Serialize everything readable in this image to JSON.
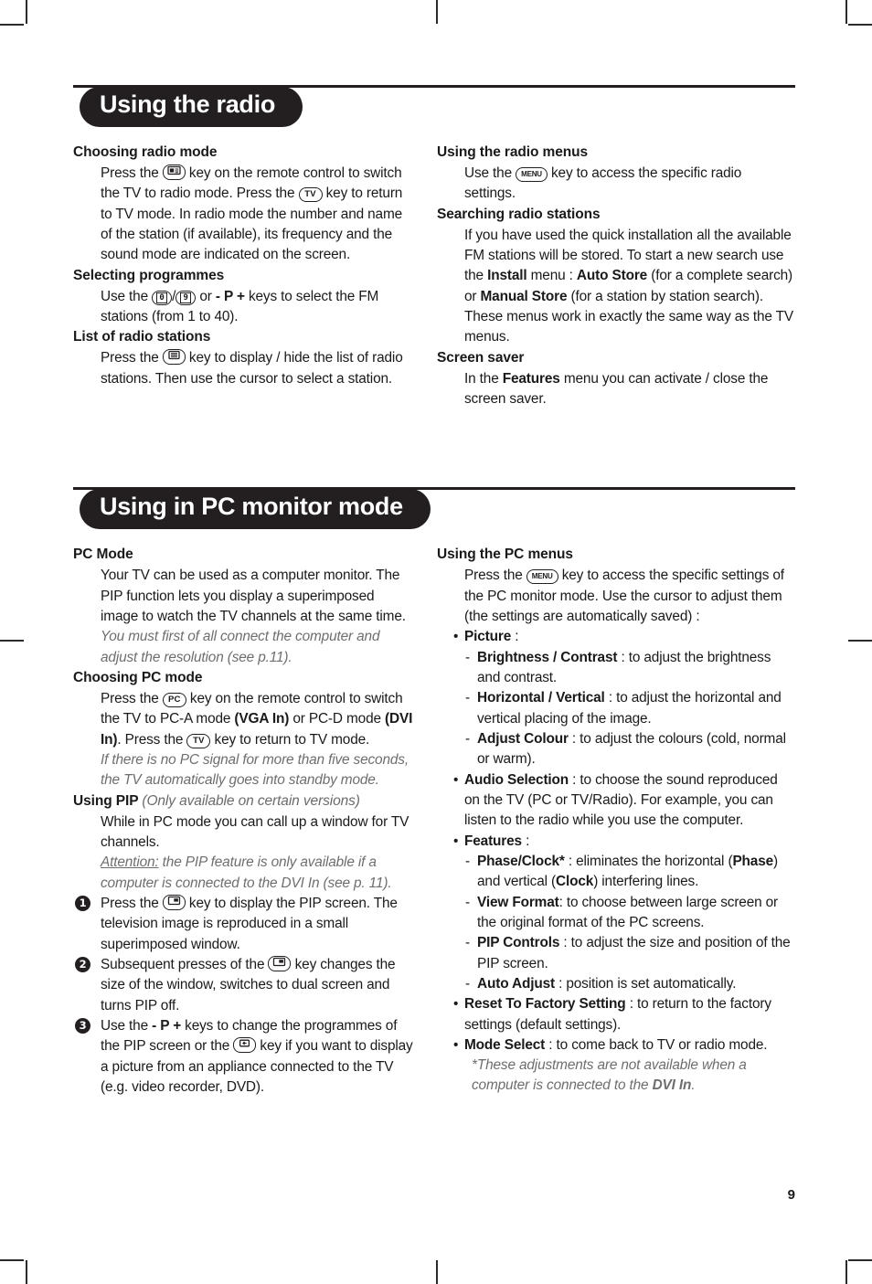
{
  "page": {
    "number": "9"
  },
  "sections": [
    {
      "banner": "Using the radio",
      "left": {
        "choosing_radio_mode": {
          "heading": "Choosing radio mode",
          "text_1": "Press the ",
          "icon_1": "radio-key-icon",
          "text_2": " key on the remote control to switch the TV to radio mode.  Press the ",
          "icon_2": "tv-key-icon",
          "text_3": " key to return to TV mode.  In radio mode the number and name of the station (if available), its frequency and the sound mode are indicated on the screen."
        },
        "selecting_programmes": {
          "heading": "Selecting programmes",
          "text_1": "Use the ",
          "icon_1": "digit-zero-key-icon",
          "separator": "/",
          "icon_2": "digit-nine-key-icon",
          "text_2": " or ",
          "bold_1": "- P +",
          "text_3": " keys to select the FM stations (from 1 to 40)."
        },
        "list_of_radio_stations": {
          "heading": "List of radio stations",
          "text_1": "Press the ",
          "icon_1": "list-key-icon",
          "text_2": " key to display / hide the list of radio stations. Then use the cursor to select a station."
        }
      },
      "right": {
        "using_the_radio_menus": {
          "heading": "Using the radio menus",
          "text_1": "Use the ",
          "icon_1": "menu-key-icon",
          "text_2": " key to access the specific radio settings."
        },
        "searching_radio_stations": {
          "heading": "Searching radio stations",
          "text_1": "If you have used the quick installation all the available FM stations will be stored. To start a new search use the ",
          "bold_1": "Install",
          "text_2": " menu : ",
          "bold_2": "Auto Store",
          "text_3": " (for a complete search) or ",
          "bold_3": "Manual Store",
          "text_4": " (for a station by station search). These menus work in exactly the same way as the TV menus."
        },
        "screen_saver": {
          "heading": "Screen saver",
          "text_1": "In the ",
          "bold_1": "Features",
          "text_2": " menu you can activate / close the screen saver."
        }
      }
    },
    {
      "banner": "Using in PC monitor mode",
      "left": {
        "pc_mode": {
          "heading": "PC Mode",
          "text_1": "Your TV can be used as a computer monitor. The PIP function lets you display a superimposed image to watch the TV channels at the same time.",
          "note_1": "You must first of all connect the computer and adjust the resolution (see p.11)."
        },
        "choosing_pc_mode": {
          "heading": "Choosing PC mode",
          "text_1": "Press the ",
          "icon_1": "pc-key-icon",
          "text_2": " key on the remote control to switch the TV to PC-A mode ",
          "bold_1": "(VGA In)",
          "text_3": " or PC-D mode ",
          "bold_2": "(DVI In)",
          "text_4": ". Press the ",
          "icon_2": "tv-key-icon",
          "text_5": " key to return to TV mode.",
          "note_1": "If there is no PC signal for more than five seconds, the TV automatically goes into standby mode."
        },
        "using_pip": {
          "heading": "Using PIP",
          "heading_note": "(Only available on certain versions)",
          "text_1": "While in PC mode you can call up a window for TV channels.",
          "note_label": "Attention:",
          "note_1": " the PIP feature is only available if a computer is connected to the DVI In (see p. 11).",
          "steps": [
            {
              "num": "1",
              "text_1": "Press the ",
              "icon_1": "pip-key-icon",
              "text_2": " key to display the PIP screen. The television image is reproduced in a small superimposed window."
            },
            {
              "num": "2",
              "text_1": "Subsequent presses of the ",
              "icon_1": "pip-key-icon",
              "text_2": " key changes the size of the window, switches to dual screen and turns PIP off."
            },
            {
              "num": "3",
              "text_1": "Use the ",
              "bold_1": "- P +",
              "text_2": " keys to change the programmes of the PIP screen or the ",
              "icon_1": "av-source-key-icon",
              "text_3": " key if you want to display a picture from an appliance connected to the TV (e.g. video recorder, DVD)."
            }
          ]
        }
      },
      "right": {
        "using_the_pc_menus": {
          "heading": "Using the PC menus",
          "text_1": "Press the ",
          "icon_1": "menu-key-icon",
          "text_2": " key to access the specific settings of the PC monitor mode.  Use the cursor to adjust them (the settings are automatically saved) :",
          "items": [
            {
              "kind": "bullet",
              "bold": "Picture",
              "text": " :"
            },
            {
              "kind": "dash",
              "bold": "Brightness / Contrast",
              "text": " : to adjust the brightness and contrast."
            },
            {
              "kind": "dash",
              "bold": "Horizontal / Vertical",
              "text": " : to adjust the horizontal and vertical placing of the image."
            },
            {
              "kind": "dash",
              "bold": "Adjust Colour",
              "text": " : to adjust the colours (cold, normal or warm)."
            },
            {
              "kind": "bullet",
              "bold": "Audio Selection",
              "text": " : to choose the sound reproduced on the TV (PC or TV/Radio). For example, you can listen to the radio while you use the computer."
            },
            {
              "kind": "bullet",
              "bold": "Features",
              "text": " :"
            },
            {
              "kind": "dash-phase",
              "bold": "Phase/Clock",
              "star": "*",
              "text_1": " : eliminates the horizontal (",
              "bold_2": "Phase",
              "text_2": ") and vertical (",
              "bold_3": "Clock",
              "text_3": ") interfering lines."
            },
            {
              "kind": "dash",
              "bold": "View Format",
              "text": ": to choose between large screen or the original format of the PC screens."
            },
            {
              "kind": "dash",
              "bold": "PIP Controls",
              "text": " : to adjust the size and position of the PIP screen."
            },
            {
              "kind": "dash",
              "bold": "Auto Adjust",
              "text": " : position is set automatically."
            },
            {
              "kind": "bullet",
              "bold": "Reset To Factory Setting",
              "text": " : to return to the factory settings (default settings)."
            },
            {
              "kind": "bullet",
              "bold": "Mode Select",
              "text": " : to come back to TV or radio mode."
            }
          ],
          "footnote_1": "*These adjustments are not available when a computer is connected to the ",
          "footnote_bold": "DVI In",
          "footnote_2": "."
        }
      }
    }
  ]
}
